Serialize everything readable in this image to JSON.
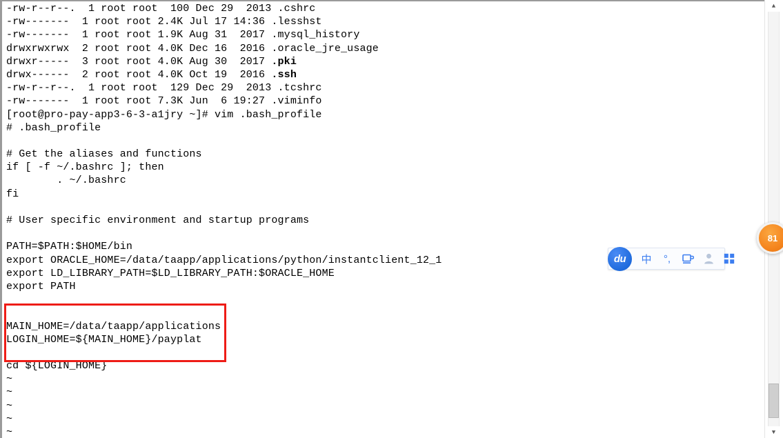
{
  "window": {
    "title": "vim .bash_profile",
    "background": "#ffffff",
    "text_color": "#000000"
  },
  "terminal": {
    "lines": [
      {
        "text": "-rw-r--r--.  1 root root  100 Dec 29  2013 .cshrc",
        "bold": false
      },
      {
        "text": "-rw-------  1 root root 2.4K Jul 17 14:36 .lesshst",
        "bold": false
      },
      {
        "text": "-rw-------  1 root root 1.9K Aug 31  2017 .mysql_history",
        "bold": false
      },
      {
        "text": "drwxrwxrwx  2 root root 4.0K Dec 16  2016 .oracle_jre_usage",
        "bold": false
      },
      {
        "text": "drwxr-----  3 root root 4.0K Aug 30  2017 .pki",
        "bold": "tail"
      },
      {
        "text": "drwx------  2 root root 4.0K Oct 19  2016 .ssh",
        "bold": "tail"
      },
      {
        "text": "-rw-r--r--.  1 root root  129 Dec 29  2013 .tcshrc",
        "bold": false
      },
      {
        "text": "-rw-------  1 root root 7.3K Jun  6 19:27 .viminfo",
        "bold": false
      },
      {
        "text": "[root@pro-pay-app3-6-3-a1jry ~]# vim .bash_profile",
        "bold": false
      },
      {
        "text": "# .bash_profile",
        "bold": false
      },
      {
        "text": "",
        "bold": false
      },
      {
        "text": "# Get the aliases and functions",
        "bold": false
      },
      {
        "text": "if [ -f ~/.bashrc ]; then",
        "bold": false
      },
      {
        "text": "        . ~/.bashrc",
        "bold": false
      },
      {
        "text": "fi",
        "bold": false
      },
      {
        "text": "",
        "bold": false
      },
      {
        "text": "# User specific environment and startup programs",
        "bold": false
      },
      {
        "text": "",
        "bold": false
      },
      {
        "text": "PATH=$PATH:$HOME/bin",
        "bold": false
      },
      {
        "text": "export ORACLE_HOME=/data/taapp/applications/python/instantclient_12_1",
        "bold": false
      },
      {
        "text": "export LD_LIBRARY_PATH=$LD_LIBRARY_PATH:$ORACLE_HOME",
        "bold": false
      },
      {
        "text": "export PATH",
        "bold": false
      },
      {
        "text": "",
        "bold": false
      },
      {
        "text": "",
        "bold": false
      },
      {
        "text": "MAIN_HOME=/data/taapp/applications",
        "bold": false
      },
      {
        "text": "LOGIN_HOME=${MAIN_HOME}/payplat",
        "bold": false
      },
      {
        "text": "",
        "bold": false
      },
      {
        "text": "cd ${LOGIN_HOME}",
        "bold": false
      }
    ],
    "empty_markers": [
      "~",
      "~",
      "~",
      "~",
      "~"
    ]
  },
  "annotation": {
    "color": "#ee1c16",
    "label": "highlighted-config-block",
    "contents": [
      "MAIN_HOME=/data/taapp/applications",
      "LOGIN_HOME=${MAIN_HOME}/payplat",
      "",
      "cd ${LOGIN_HOME}"
    ]
  },
  "ime_toolbar": {
    "logo_text": "du",
    "logo_color": "#2b6ce8",
    "accent_color": "#3d7ef0",
    "items": [
      {
        "name": "language-mode-icon",
        "glyph": "中",
        "dim": false
      },
      {
        "name": "punctuation-mode-icon",
        "glyph": "°,",
        "dim": false
      },
      {
        "name": "keyboard-tray-icon",
        "glyph": "",
        "dim": false
      },
      {
        "name": "user-account-icon",
        "glyph": "",
        "dim": true
      },
      {
        "name": "toolbox-grid-icon",
        "glyph": "",
        "dim": false
      }
    ]
  },
  "scrollbar": {
    "up_arrow": "▲",
    "down_arrow": "▼",
    "thumb_position": "near-bottom"
  },
  "side_badge": {
    "text": "81",
    "color": "#f5861f"
  }
}
